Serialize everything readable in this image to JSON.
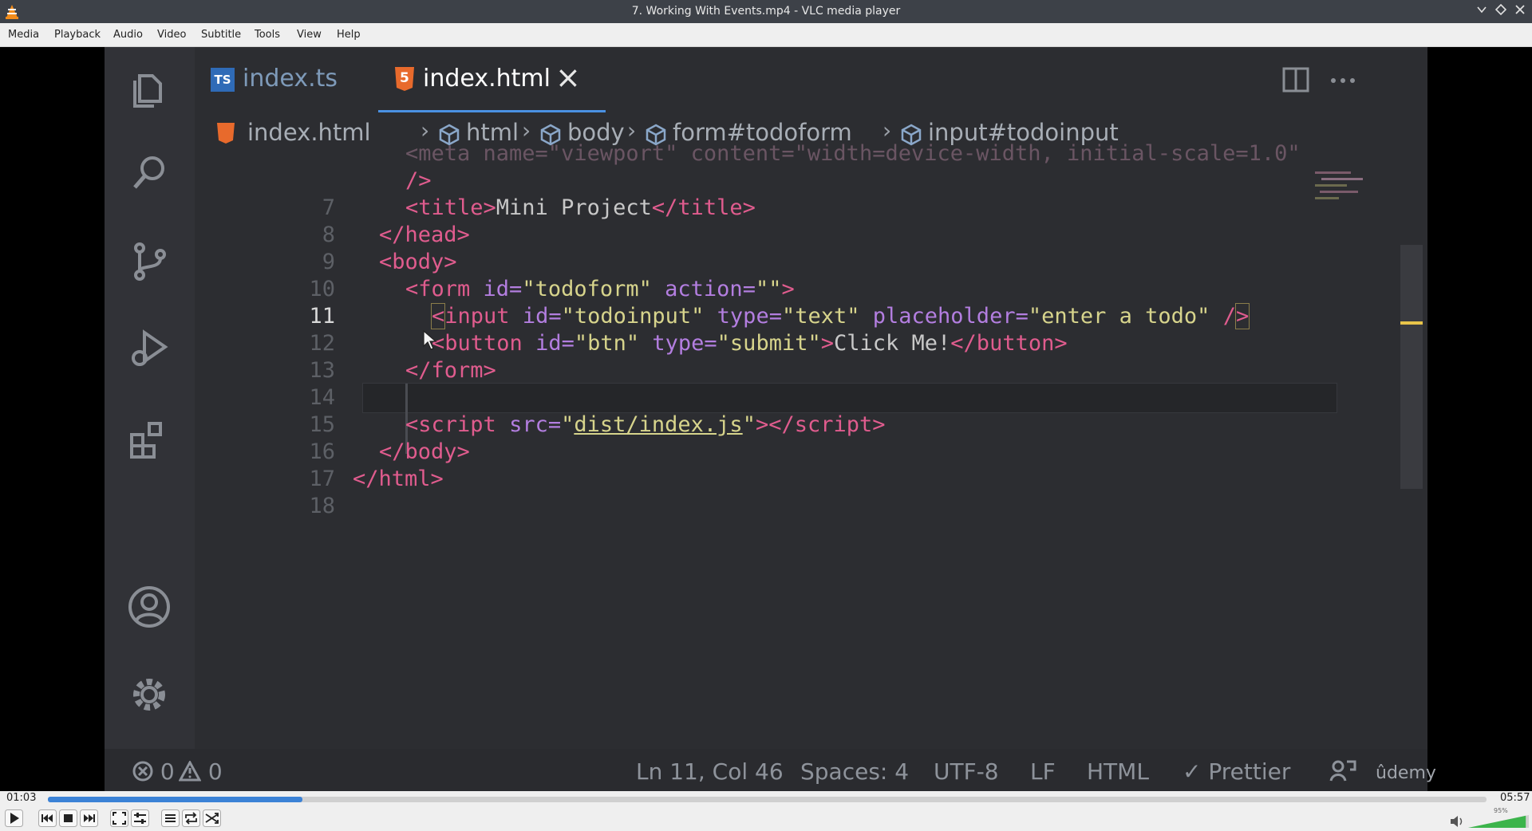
{
  "window": {
    "title": "7. Working With Events.mp4 - VLC media player",
    "minimize_icon": "chevron-down-icon",
    "maximize_icon": "restore-icon",
    "close_icon": "close-icon"
  },
  "menu": [
    "Media",
    "Playback",
    "Audio",
    "Video",
    "Subtitle",
    "Tools",
    "View",
    "Help"
  ],
  "video": {
    "tabs": [
      {
        "badge": "TS",
        "label": "index.ts",
        "active": false
      },
      {
        "badge": "5",
        "label": "index.html",
        "active": true,
        "close": "×"
      }
    ],
    "breadcrumb": [
      "index.html",
      "html",
      "body",
      "form#todoform",
      "input#todoinput"
    ],
    "line_numbers": [
      "7",
      "8",
      "9",
      "10",
      "11",
      "12",
      "13",
      "14",
      "15",
      "16",
      "17",
      "18"
    ],
    "active_line": "11",
    "status": {
      "errors": "0",
      "warnings": "0",
      "position": "Ln 11, Col 46",
      "spaces": "Spaces: 4",
      "encoding": "UTF-8",
      "eol": "LF",
      "language": "HTML",
      "formatter": "✓ Prettier",
      "watermark": "ûdemy"
    },
    "colors": {
      "editor_bg": "#2c2d31",
      "tag": "#e05c8e",
      "attr": "#b37ee0",
      "string": "#d7d48c",
      "highlight": "#e8c44a"
    }
  },
  "player": {
    "elapsed": "01:03",
    "total": "05:57",
    "progress": 0.177,
    "volume_label": "95%",
    "volume": 0.95,
    "accent": "#3b82d6"
  }
}
